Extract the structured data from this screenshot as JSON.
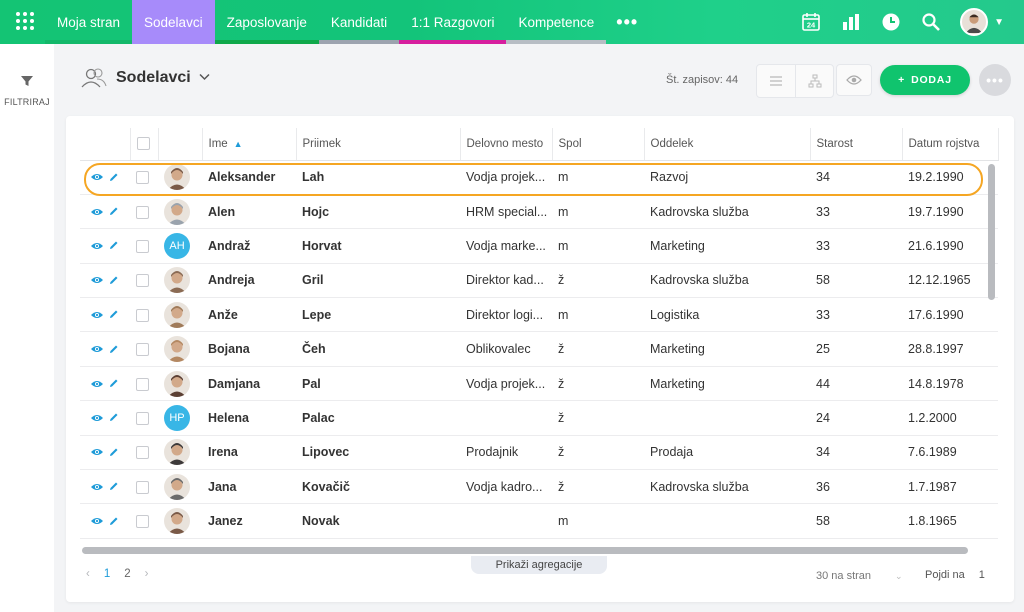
{
  "nav": {
    "tabs": [
      {
        "label": "Moja stran",
        "bar": "#13b86a"
      },
      {
        "label": "Sodelavci",
        "bar": "#a78bfa",
        "active": true
      },
      {
        "label": "Zaposlovanje",
        "bar": "#0fa84a"
      },
      {
        "label": "Kandidati",
        "bar": "#9ca3af"
      },
      {
        "label": "1:1 Razgovori",
        "bar": "#d61e9e"
      },
      {
        "label": "Kompetence",
        "bar": "#b7bdc4"
      }
    ],
    "calendar_day": "24"
  },
  "rail": {
    "filter_label": "FILTRIRAJ"
  },
  "header": {
    "title": "Sodelavci",
    "records_text": "Št. zapisov: 44",
    "add_label": "DODAJ",
    "add_plus": "+",
    "more_dots": "•••"
  },
  "table": {
    "columns": [
      "Ime",
      "Priimek",
      "Delovno mesto",
      "Spol",
      "Oddelek",
      "Starost",
      "Datum rojstva"
    ],
    "rows": [
      {
        "ime": "Aleksander",
        "priimek": "Lah",
        "delovno": "Vodja projek...",
        "spol": "m",
        "oddelek": "Razvoj",
        "starost": "34",
        "datum": "19.2.1990",
        "avatar": "photo"
      },
      {
        "ime": "Alen",
        "priimek": "Hojc",
        "delovno": "HRM special...",
        "spol": "m",
        "oddelek": "Kadrovska služba",
        "starost": "33",
        "datum": "19.7.1990",
        "avatar": "photo"
      },
      {
        "ime": "Andraž",
        "priimek": "Horvat",
        "delovno": "Vodja marke...",
        "spol": "m",
        "oddelek": "Marketing",
        "starost": "33",
        "datum": "21.6.1990",
        "avatar": "AH"
      },
      {
        "ime": "Andreja",
        "priimek": "Gril",
        "delovno": "Direktor kad...",
        "spol": "ž",
        "oddelek": "Kadrovska služba",
        "starost": "58",
        "datum": "12.12.1965",
        "avatar": "photo"
      },
      {
        "ime": "Anže",
        "priimek": "Lepe",
        "delovno": "Direktor logi...",
        "spol": "m",
        "oddelek": "Logistika",
        "starost": "33",
        "datum": "17.6.1990",
        "avatar": "photo"
      },
      {
        "ime": "Bojana",
        "priimek": "Čeh",
        "delovno": "Oblikovalec",
        "spol": "ž",
        "oddelek": "Marketing",
        "starost": "25",
        "datum": "28.8.1997",
        "avatar": "photo"
      },
      {
        "ime": "Damjana",
        "priimek": "Pal",
        "delovno": "Vodja projek...",
        "spol": "ž",
        "oddelek": "Marketing",
        "starost": "44",
        "datum": "14.8.1978",
        "avatar": "photo"
      },
      {
        "ime": "Helena",
        "priimek": "Palac",
        "delovno": "",
        "spol": "ž",
        "oddelek": "",
        "starost": "24",
        "datum": "1.2.2000",
        "avatar": "HP"
      },
      {
        "ime": "Irena",
        "priimek": "Lipovec",
        "delovno": "Prodajnik",
        "spol": "ž",
        "oddelek": "Prodaja",
        "starost": "34",
        "datum": "7.6.1989",
        "avatar": "photo"
      },
      {
        "ime": "Jana",
        "priimek": "Kovačič",
        "delovno": "Vodja kadro...",
        "spol": "ž",
        "oddelek": "Kadrovska služba",
        "starost": "36",
        "datum": "1.7.1987",
        "avatar": "photo"
      },
      {
        "ime": "Janez",
        "priimek": "Novak",
        "delovno": "",
        "spol": "m",
        "oddelek": "",
        "starost": "58",
        "datum": "1.8.1965",
        "avatar": "photo"
      }
    ]
  },
  "footer": {
    "aggregation_label": "Prikaži agregacije",
    "pages": [
      "1",
      "2"
    ],
    "per_page": "30 na stran",
    "goto_label": "Pojdi na",
    "goto_value": "1"
  },
  "colors": {
    "accent": "#10c46e",
    "highlight": "#f5a623",
    "link": "#1e9bd8"
  }
}
